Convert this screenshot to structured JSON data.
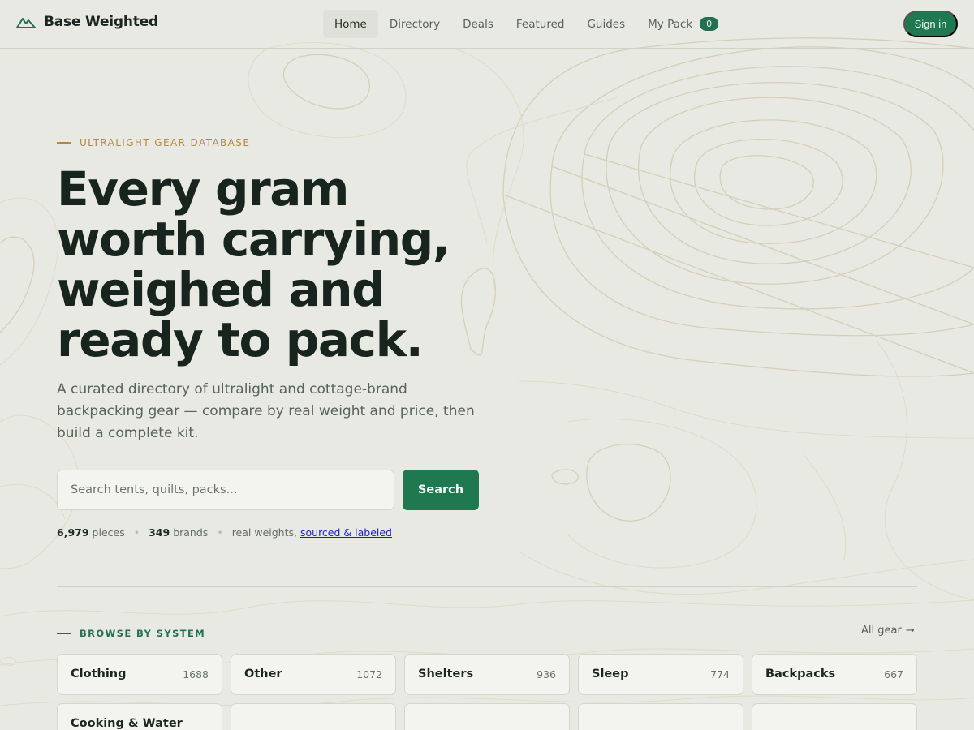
{
  "brand": {
    "name": "Base Weighted",
    "icon": "mountain-icon"
  },
  "nav": {
    "links": [
      {
        "label": "Home",
        "active": true
      },
      {
        "label": "Directory",
        "active": false
      },
      {
        "label": "Deals",
        "active": false
      },
      {
        "label": "Featured",
        "active": false
      },
      {
        "label": "Guides",
        "active": false
      },
      {
        "label": "My Pack",
        "active": false,
        "badge": "0"
      }
    ],
    "signin_label": "Sign in"
  },
  "hero": {
    "eyebrow": "ULTRALIGHT GEAR DATABASE",
    "headline": "Every gram\nworth carrying,\nweighed and\nready to pack.",
    "subhead": "A curated directory of ultralight and cottage-brand backpacking gear — compare by real weight and price, then build a complete kit.",
    "search_placeholder": "Search tents, quilts, packs...",
    "search_button": "Search",
    "stats": {
      "pieces_value": "6,979",
      "pieces_label": "pieces",
      "brands_value": "349",
      "brands_label": "brands",
      "weights_text": "real weights,",
      "weights_link": "sourced & labeled"
    }
  },
  "browse": {
    "label": "BROWSE BY SYSTEM",
    "all_gear": "All gear",
    "categories": [
      {
        "name": "Clothing",
        "count": "1688"
      },
      {
        "name": "Other",
        "count": "1072"
      },
      {
        "name": "Shelters",
        "count": "936"
      },
      {
        "name": "Sleep",
        "count": "774"
      },
      {
        "name": "Backpacks",
        "count": "667"
      },
      {
        "name": "Cooking & Water",
        "count": ""
      },
      {
        "name": "",
        "count": ""
      },
      {
        "name": "",
        "count": ""
      },
      {
        "name": "",
        "count": ""
      },
      {
        "name": "",
        "count": ""
      }
    ]
  },
  "colors": {
    "background": "#e8e9e2",
    "accent_green": "#1f7850",
    "accent_gold": "#b9863f",
    "link_blue": "#1a1ad0"
  }
}
